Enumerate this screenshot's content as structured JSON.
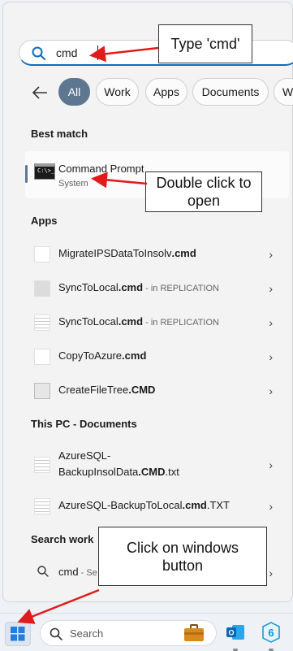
{
  "search": {
    "query": "cmd"
  },
  "filters": [
    "All",
    "Work",
    "Apps",
    "Documents",
    "W"
  ],
  "best_match": {
    "heading": "Best match",
    "title": "Command Prompt",
    "subtitle": "System",
    "icon_text": "C:\\>_"
  },
  "apps": {
    "heading": "Apps",
    "items": [
      {
        "name": "MigrateIPSDataToInsolv",
        "ext": ".cmd",
        "location": "",
        "icon": "blank-file-icon"
      },
      {
        "name": "SyncToLocal",
        "ext": ".cmd",
        "location": " - in REPLICATION",
        "icon": "settings-file-icon"
      },
      {
        "name": "SyncToLocal",
        "ext": ".cmd",
        "location": " - in REPLICATION",
        "icon": "text-file-icon"
      },
      {
        "name": "CopyToAzure",
        "ext": ".cmd",
        "location": "",
        "icon": "blank-file-icon"
      },
      {
        "name": "CreateFileTree",
        "ext": ".CMD",
        "location": "",
        "icon": "blurred-file-icon"
      }
    ]
  },
  "documents": {
    "heading": "This PC - Documents",
    "items": [
      {
        "line1": "AzureSQL-",
        "line2_pre": "BackupInsolData",
        "ext": ".CMD",
        "line2_post": ".txt"
      },
      {
        "line1": "AzureSQL-BackupToLocal",
        "ext": ".cmd",
        "post": ".TXT"
      }
    ]
  },
  "search_work": {
    "heading": "Search work",
    "query": "cmd",
    "suffix": " - Se"
  },
  "taskbar": {
    "search_placeholder": "Search"
  },
  "callouts": {
    "type_cmd": "Type 'cmd'",
    "double_click": "Double click to open",
    "windows_button": "Click on windows button"
  },
  "colors": {
    "accent": "#5e7791",
    "arrow": "#e01b1b",
    "search_underline": "#0f6cbd"
  }
}
